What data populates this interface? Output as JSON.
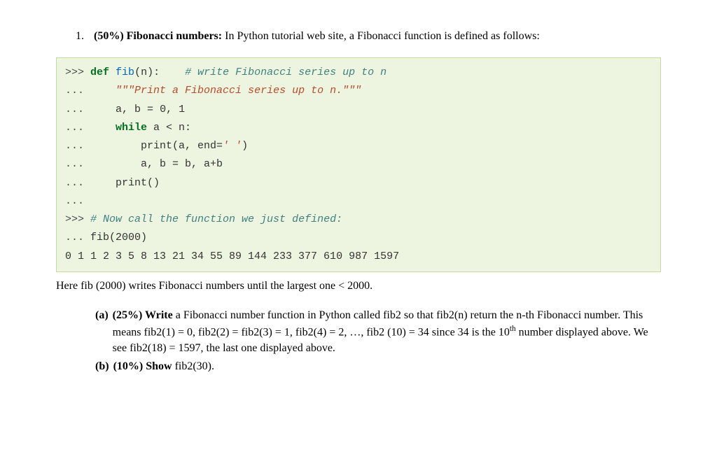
{
  "question": {
    "number": "1.",
    "weight": "(50%)",
    "title": "Fibonacci numbers:",
    "intro": "In Python tutorial web site, a Fibonacci function is defined as follows:"
  },
  "code": {
    "p1": ">>> ",
    "p2": "... ",
    "kw_def": "def",
    "fn_name": "fib",
    "sig_open": "(n):",
    "comment1": "# write Fibonacci series up to n",
    "docstring": "\"\"\"Print a Fibonacci series up to n.\"\"\"",
    "line_ab_init_a": "a, b ",
    "line_ab_init_b": "=",
    "line_ab_init_c": " 0, 1",
    "kw_while": "while",
    "while_cond": " a < n:",
    "print_call_a": "print",
    "print_call_b": "(a, end=",
    "print_call_c": "' '",
    "print_call_d": ")",
    "line_ab_update": "a, b = b, a+b",
    "print_empty_a": "print",
    "print_empty_b": "()",
    "comment2": "# Now call the function we just defined:",
    "call": "fib(2000)",
    "output": "0 1 1 2 3 5 8 13 21 34 55 89 144 233 377 610 987 1597"
  },
  "midtext": "Here fib (2000) writes Fibonacci numbers until the largest one < 2000.",
  "parts": {
    "a": {
      "label": "(a)",
      "weight": "(25%)",
      "verb": "Write",
      "text1": " a Fibonacci number function in Python called fib2 so that fib2(n) return the n-th Fibonacci number. This means fib2(1) = 0, fib2(2) = fib2(3) = 1, fib2(4) = 2, …, fib2 (10) = 34 since 34 is the 10",
      "sup": "th",
      "text2": " number displayed above. We see fib2(18) = 1597, the last one displayed above."
    },
    "b": {
      "label": "(b)",
      "weight": "(10%)",
      "verb": "Show",
      "text": " fib2(30)."
    }
  }
}
